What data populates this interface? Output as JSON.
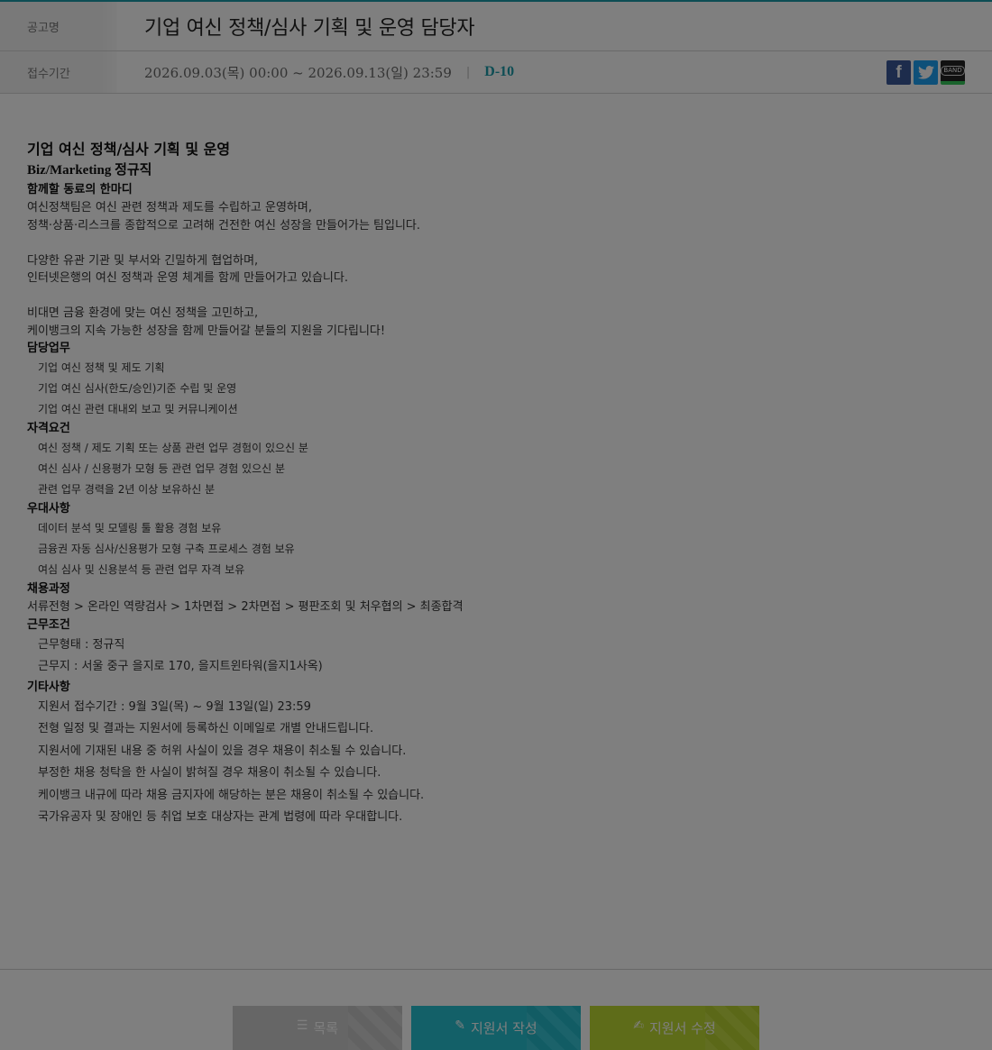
{
  "header": {
    "title_label": "공고명",
    "title": "기업 여신 정책/심사 기획 및 운영 담당자",
    "period_label": "접수기간",
    "period": "2026.09.03(목) 00:00 ~ 2026.09.13(일) 23:59",
    "separator": "|",
    "dday": "D-10",
    "share": {
      "facebook": "f",
      "band": "BAND"
    }
  },
  "content": {
    "heading": "기업 여신 정책/심사 기획 및 운영",
    "subheading": "Biz/Marketing 정규직",
    "intro_title": "함께할 동료의 한마디",
    "intro": [
      "여신정책팀은 여신 관련 정책과 제도를 수립하고 운영하며,",
      "정책·상품·리스크를 종합적으로 고려해 건전한 여신 성장을 만들어가는 팀입니다.",
      "",
      "다양한 유관 기관 및 부서와 긴밀하게 협업하며,",
      "인터넷은행의 여신 정책과 운영 체계를 함께 만들어가고 있습니다.",
      "",
      "비대면 금융 환경에 맞는 여신 정책을 고민하고,",
      "케이뱅크의 지속 가능한 성장을 함께 만들어갈 분들의 지원을 기다립니다!"
    ],
    "duties_title": "담당업무",
    "duties": [
      "기업 여신 정책 및 제도 기획",
      "기업 여신 심사(한도/승인)기준 수립 및 운영",
      "기업 여신 관련 대내외 보고 및 커뮤니케이션"
    ],
    "requirements_title": "자격요건",
    "requirements": [
      "여신 정책 / 제도 기획 또는 상품 관련 업무 경험이 있으신 분",
      "여신 심사 / 신용평가 모형 등 관련 업무 경험 있으신 분",
      "관련 업무 경력을 2년 이상 보유하신 분"
    ],
    "preferred_title": "우대사항",
    "preferred": [
      "데이터 분석 및 모델링 툴 활용 경험 보유",
      "금융권 자동 심사/신용평가 모형 구축 프로세스 경험 보유",
      "여심 심사 및 신용분석 등 관련 업무 자격 보유"
    ],
    "process_title": "채용과정",
    "process": "서류전형 > 온라인 역량검사 > 1차면접 > 2차면접 > 평판조회 및 처우협의 > 최종합격",
    "conditions_title": "근무조건",
    "conditions": [
      "근무형태 : 정규직",
      "근무지 : 서울 중구 을지로 170, 을지트윈타워(을지1사옥)"
    ],
    "etc_title": "기타사항",
    "etc": [
      "지원서 접수기간 : 9월 3일(목) ~ 9월 13일(일) 23:59",
      "전형 일정 및 결과는 지원서에 등록하신 이메일로 개별 안내드립니다.",
      "지원서에 기재된 내용 중 허위 사실이 있을 경우 채용이 취소될 수 있습니다.",
      "부정한 채용 청탁을 한 사실이 밝혀질 경우 채용이 취소될 수 있습니다.",
      "케이뱅크 내규에 따라 채용 금지자에 해당하는 분은 채용이 취소될 수 있습니다.",
      "국가유공자 및 장애인 등 취업 보호 대상자는 관계 법령에 따라 우대합니다."
    ]
  },
  "buttons": {
    "list": "목록",
    "write": "지원서 작성",
    "edit": "지원서 수정"
  }
}
